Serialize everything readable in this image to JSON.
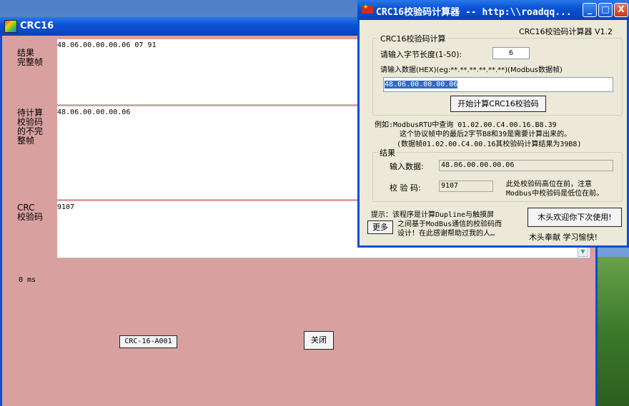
{
  "main_window": {
    "title": "CRC16",
    "labels": {
      "result": [
        "结果",
        "完整帧"
      ],
      "partial": [
        "待计算",
        "校验码",
        "的不完",
        "整帧"
      ],
      "crc": [
        "CRC",
        "校验码"
      ]
    },
    "result_frame": "48.06.00.00.00.06 07 91",
    "partial_frame": "48.06.00.00.00.06",
    "crc_value": "9107",
    "elapsed": "0 ms",
    "crc_type_button": "CRC-16-A001",
    "close_button": "关闭"
  },
  "calc_window": {
    "title": "CRC16校验码计算器 -- http:\\\\roadqq...",
    "version": "CRC16校验码计算器 V1.2",
    "group_calc_label": "CRC16校验码计算",
    "length_prompt": "请输入字节长度(1-50):",
    "length_value": "6",
    "data_prompt": "请输入数据(HEX)(eg:**.**.**.**.**.**)(Modbus数据帧)",
    "hex_value": "48.06.00.00.00.06",
    "calc_button": "开始计算CRC16校验码",
    "example_lines": [
      "例如:ModbusRTU中查询 01.02.00.C4.00.16.B8.39",
      "这个协议帧中的最后2字节B8和39是需要计算出来的。",
      "(数据帧01.02.00.C4.00.16其校验码计算结果为39B8)"
    ],
    "group_result_label": "结果",
    "input_data_label": "输入数据:",
    "input_data_value": "48.06.00.00.00.06",
    "crc_label": "校 验 码:",
    "crc_value": "9107",
    "crc_note_lines": [
      "此处校验码高位在前，注意",
      "Modbus中校验码是低位在前。"
    ],
    "tip_lines": [
      "提示：该程序是计算Dupline与触摸屏",
      "之间基于ModBus通信的校验码而",
      "设计！在此感谢帮助过我的人…"
    ],
    "more_button": "更多",
    "welcome_button": "木头欢迎你下次使用!",
    "footer": "木头奉献  学习愉快!"
  },
  "window_controls": {
    "minimize": "_",
    "maximize": "□",
    "close": "X"
  }
}
